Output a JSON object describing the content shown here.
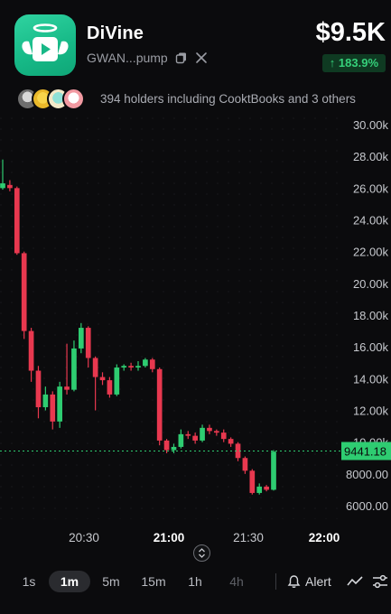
{
  "header": {
    "token_name": "DiVine",
    "address_short": "GWAN...pump",
    "copy_icon": "copy-icon",
    "x_icon": "x-social-icon",
    "price": "$9.5K",
    "change": "↑ 183.9%",
    "change_color": "#35d07a"
  },
  "holders": {
    "text": "394 holders including CooktBooks and 3 others"
  },
  "chart_data": {
    "type": "candlestick",
    "y_ticks": [
      "30.00k",
      "28.00k",
      "26.00k",
      "24.00k",
      "22.00k",
      "20.00k",
      "18.00k",
      "16.00k",
      "14.00k",
      "12.00k",
      "10.00k",
      "8000.00",
      "6000.00"
    ],
    "x_ticks": [
      "20:30",
      "21:00",
      "21:30",
      "22:00"
    ],
    "ylim": [
      6000,
      30000
    ],
    "current_price_label": "9441.18",
    "current_price": 9441.18,
    "up_color": "#2ecc71",
    "down_color": "#e8384f",
    "candles": [
      {
        "o": 26000,
        "c": 26300,
        "h": 27800,
        "l": 25900
      },
      {
        "o": 26200,
        "c": 26000,
        "h": 26500,
        "l": 25800
      },
      {
        "o": 26000,
        "c": 21900,
        "h": 26100,
        "l": 21800
      },
      {
        "o": 21900,
        "c": 17000,
        "h": 22000,
        "l": 16500
      },
      {
        "o": 17000,
        "c": 14500,
        "h": 17200,
        "l": 13800
      },
      {
        "o": 14500,
        "c": 12200,
        "h": 14800,
        "l": 11500
      },
      {
        "o": 12200,
        "c": 13000,
        "h": 13500,
        "l": 12000
      },
      {
        "o": 13000,
        "c": 11300,
        "h": 13200,
        "l": 10800
      },
      {
        "o": 11300,
        "c": 13500,
        "h": 13800,
        "l": 10900
      },
      {
        "o": 13500,
        "c": 13300,
        "h": 16200,
        "l": 13000
      },
      {
        "o": 13300,
        "c": 15900,
        "h": 16400,
        "l": 13200
      },
      {
        "o": 15900,
        "c": 17200,
        "h": 17500,
        "l": 15600
      },
      {
        "o": 17200,
        "c": 15300,
        "h": 17300,
        "l": 14700
      },
      {
        "o": 15300,
        "c": 14100,
        "h": 15400,
        "l": 12000
      },
      {
        "o": 14100,
        "c": 13900,
        "h": 14400,
        "l": 13600
      },
      {
        "o": 13900,
        "c": 13000,
        "h": 14100,
        "l": 12800
      },
      {
        "o": 13000,
        "c": 14700,
        "h": 14900,
        "l": 12900
      },
      {
        "o": 14700,
        "c": 14800,
        "h": 14900,
        "l": 14500
      },
      {
        "o": 14800,
        "c": 14700,
        "h": 15000,
        "l": 14500
      },
      {
        "o": 14700,
        "c": 14800,
        "h": 15100,
        "l": 14500
      },
      {
        "o": 14800,
        "c": 15200,
        "h": 15300,
        "l": 14700
      },
      {
        "o": 15200,
        "c": 14600,
        "h": 15300,
        "l": 14400
      },
      {
        "o": 14600,
        "c": 10100,
        "h": 14700,
        "l": 9800
      },
      {
        "o": 10100,
        "c": 9500,
        "h": 10200,
        "l": 9300
      },
      {
        "o": 9500,
        "c": 9700,
        "h": 9900,
        "l": 9300
      },
      {
        "o": 9700,
        "c": 10500,
        "h": 10800,
        "l": 9600
      },
      {
        "o": 10500,
        "c": 10400,
        "h": 10700,
        "l": 10200
      },
      {
        "o": 10400,
        "c": 10100,
        "h": 10600,
        "l": 9900
      },
      {
        "o": 10100,
        "c": 10900,
        "h": 11100,
        "l": 10000
      },
      {
        "o": 10900,
        "c": 10700,
        "h": 11100,
        "l": 10500
      },
      {
        "o": 10700,
        "c": 10600,
        "h": 10800,
        "l": 10400
      },
      {
        "o": 10600,
        "c": 10200,
        "h": 10800,
        "l": 10000
      },
      {
        "o": 10200,
        "c": 9900,
        "h": 10300,
        "l": 9700
      },
      {
        "o": 9900,
        "c": 9000,
        "h": 10000,
        "l": 8800
      },
      {
        "o": 9000,
        "c": 8200,
        "h": 9100,
        "l": 8000
      },
      {
        "o": 8200,
        "c": 6800,
        "h": 8300,
        "l": 6700
      },
      {
        "o": 6800,
        "c": 7200,
        "h": 7400,
        "l": 6700
      },
      {
        "o": 7200,
        "c": 7000,
        "h": 7300,
        "l": 6900
      },
      {
        "o": 7000,
        "c": 9400,
        "h": 9500,
        "l": 6950
      }
    ]
  },
  "toolbar": {
    "timeframes": [
      "1s",
      "1m",
      "5m",
      "15m",
      "1h",
      "4h"
    ],
    "active": "1m",
    "alert_label": "Alert",
    "bell_icon": "bell-icon",
    "indicator_icon": "line-chart-icon",
    "settings_icon": "sliders-icon"
  }
}
